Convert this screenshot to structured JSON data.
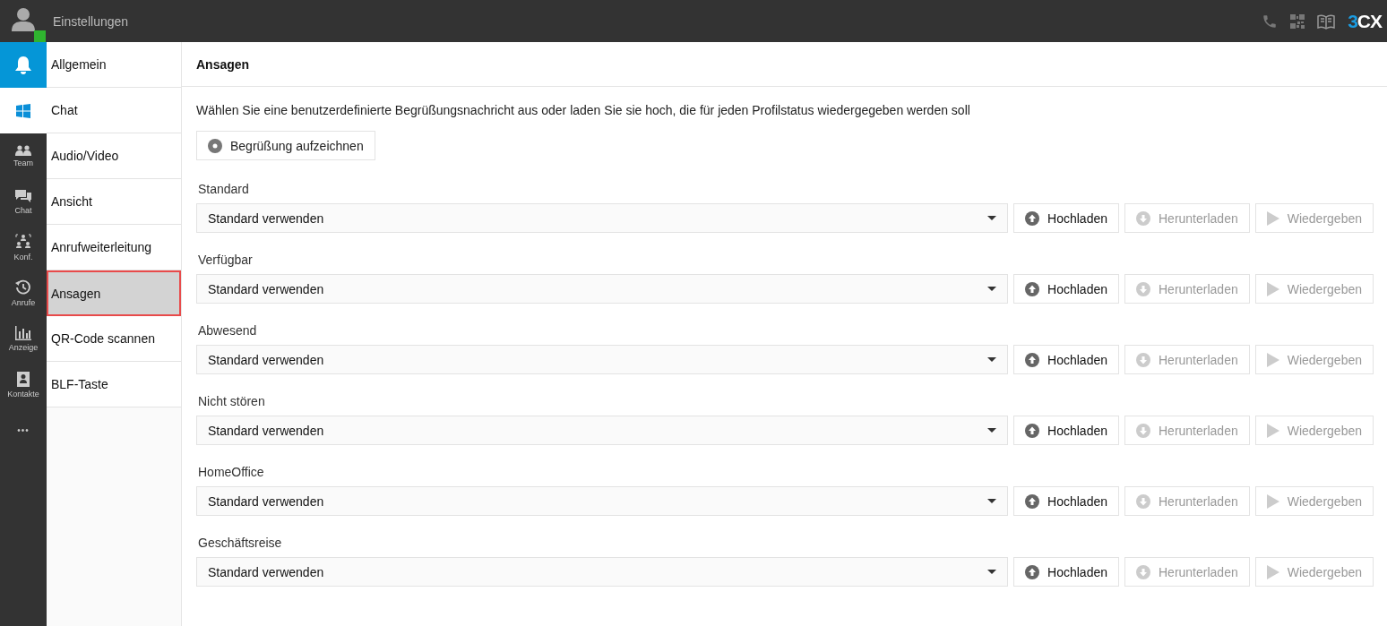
{
  "header": {
    "title": "Einstellungen",
    "logo": "3CX"
  },
  "rail": {
    "items": [
      {
        "kind": "accent"
      },
      {
        "kind": "light"
      },
      {
        "kind": "nav",
        "label": "Team"
      },
      {
        "kind": "nav",
        "label": "Chat"
      },
      {
        "kind": "nav",
        "label": "Konf."
      },
      {
        "kind": "nav",
        "label": "Anrufe"
      },
      {
        "kind": "nav",
        "label": "Anzeige"
      },
      {
        "kind": "nav",
        "label": "Kontakte"
      },
      {
        "kind": "more",
        "label": "•••"
      }
    ]
  },
  "menu": {
    "items": [
      {
        "label": "Allgemein",
        "selected": false
      },
      {
        "label": "Chat",
        "selected": false
      },
      {
        "label": "Audio/Video",
        "selected": false
      },
      {
        "label": "Ansicht",
        "selected": false
      },
      {
        "label": "Anrufweiterleitung",
        "selected": false
      },
      {
        "label": "Ansagen",
        "selected": true
      },
      {
        "label": "QR-Code scannen",
        "selected": false
      },
      {
        "label": "BLF-Taste",
        "selected": false
      }
    ]
  },
  "content": {
    "title": "Ansagen",
    "description": "Wählen Sie eine benutzerdefinierte Begrüßungsnachricht aus oder laden Sie sie hoch, die für jeden Profilstatus wiedergegeben werden soll",
    "record_button": "Begrüßung aufzeichnen",
    "rows": [
      {
        "label": "Standard",
        "value": "Standard verwenden",
        "buttons": [
          {
            "kind": "upload",
            "label": "Hochladen",
            "disabled": false
          },
          {
            "kind": "download",
            "label": "Herunterladen",
            "disabled": true
          },
          {
            "kind": "play",
            "label": "Wiedergeben",
            "disabled": true
          }
        ]
      },
      {
        "label": "Verfügbar",
        "value": "Standard verwenden",
        "buttons": [
          {
            "kind": "upload",
            "label": "Hochladen",
            "disabled": false
          },
          {
            "kind": "download",
            "label": "Herunterladen",
            "disabled": true
          },
          {
            "kind": "play",
            "label": "Wiedergeben",
            "disabled": true
          }
        ]
      },
      {
        "label": "Abwesend",
        "value": "Standard verwenden",
        "buttons": [
          {
            "kind": "upload",
            "label": "Hochladen",
            "disabled": false
          },
          {
            "kind": "download",
            "label": "Herunterladen",
            "disabled": true
          },
          {
            "kind": "play",
            "label": "Wiedergeben",
            "disabled": true
          }
        ]
      },
      {
        "label": "Nicht stören",
        "value": "Standard verwenden",
        "buttons": [
          {
            "kind": "upload",
            "label": "Hochladen",
            "disabled": false
          },
          {
            "kind": "download",
            "label": "Herunterladen",
            "disabled": true
          },
          {
            "kind": "play",
            "label": "Wiedergeben",
            "disabled": true
          }
        ]
      },
      {
        "label": "HomeOffice",
        "value": "Standard verwenden",
        "buttons": [
          {
            "kind": "upload",
            "label": "Hochladen",
            "disabled": false
          },
          {
            "kind": "download",
            "label": "Herunterladen",
            "disabled": true
          },
          {
            "kind": "play",
            "label": "Wiedergeben",
            "disabled": true
          }
        ]
      },
      {
        "label": "Geschäftsreise",
        "value": "Standard verwenden",
        "buttons": [
          {
            "kind": "upload",
            "label": "Hochladen",
            "disabled": false
          },
          {
            "kind": "download",
            "label": "Herunterladen",
            "disabled": true
          },
          {
            "kind": "play",
            "label": "Wiedergeben",
            "disabled": true
          }
        ]
      }
    ]
  }
}
